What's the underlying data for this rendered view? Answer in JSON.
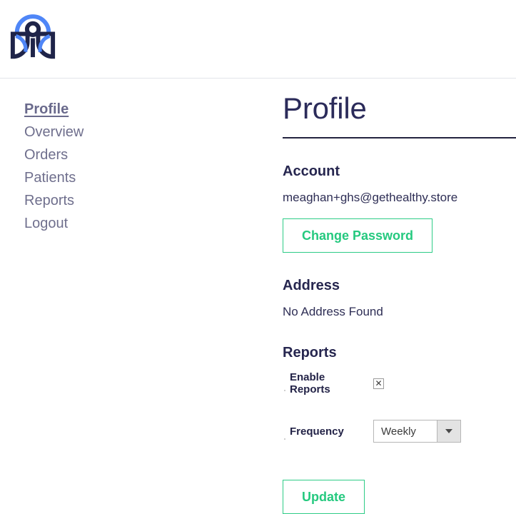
{
  "header": {
    "logo_name": "gethealthy-person-leaf-logo",
    "logo_colors": {
      "arc": "#4f86f7",
      "figure": "#1f2449"
    },
    "divider_color": "#e2e4ea"
  },
  "sidebar": {
    "items": [
      {
        "label": "Profile",
        "active": true
      },
      {
        "label": "Overview",
        "active": false
      },
      {
        "label": "Orders",
        "active": false
      },
      {
        "label": "Patients",
        "active": false
      },
      {
        "label": "Reports",
        "active": false
      },
      {
        "label": "Logout",
        "active": false
      }
    ]
  },
  "main": {
    "title": "Profile",
    "account": {
      "heading": "Account",
      "email": "meaghan+ghs@gethealthy.store",
      "change_password_label": "Change Password"
    },
    "address": {
      "heading": "Address",
      "value": "No Address Found"
    },
    "reports": {
      "heading": "Reports",
      "enable_label": "Enable Reports",
      "enable_checked": true,
      "enable_mark": "✕",
      "frequency_label": "Frequency",
      "frequency_value": "Weekly",
      "frequency_options": [
        "Weekly"
      ],
      "update_label": "Update"
    }
  },
  "colors": {
    "accent_green": "#25c97f",
    "title_navy": "#2b2b5a",
    "nav_grey": "#6f6f8d"
  }
}
